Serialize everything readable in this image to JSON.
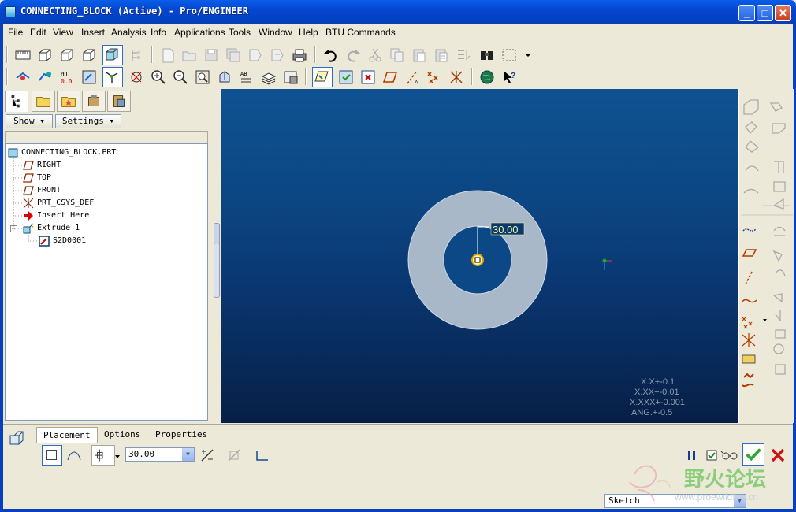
{
  "window": {
    "title": "CONNECTING_BLOCK (Active) - Pro/ENGINEER",
    "minimize_glyph": "_",
    "maximize_glyph": "□",
    "close_glyph": "✕"
  },
  "menu": [
    "File",
    "Edit",
    "View",
    "Insert",
    "Analysis",
    "Info",
    "Applications",
    "Tools",
    "Window",
    "Help",
    "BTU Commands"
  ],
  "navigator": {
    "show_label": "Show",
    "settings_label": "Settings",
    "tree": [
      {
        "label": "CONNECTING_BLOCK.PRT",
        "icon": "part-icon"
      },
      {
        "label": "RIGHT",
        "icon": "datum-plane-icon"
      },
      {
        "label": "TOP",
        "icon": "datum-plane-icon"
      },
      {
        "label": "FRONT",
        "icon": "datum-plane-icon"
      },
      {
        "label": "PRT_CSYS_DEF",
        "icon": "csys-icon"
      },
      {
        "label": "Insert Here",
        "icon": "insert-arrow-icon"
      },
      {
        "label": "Extrude 1",
        "icon": "extrude-icon"
      },
      {
        "label": "S2D0001",
        "icon": "sketch-icon"
      }
    ]
  },
  "graphics": {
    "dimension": "30.00",
    "tolerances": [
      "X.X+-0.1",
      "X.XX+-0.01",
      "X.XXX+-0.001",
      "ANG.+-0.5"
    ]
  },
  "dashboard": {
    "tabs": [
      "Placement",
      "Options",
      "Properties"
    ],
    "depth_value": "30.00"
  },
  "status": {
    "filter_value": "Sketch"
  },
  "watermark": {
    "text_cn": "野火论坛",
    "url": "www.proewildfire.cn"
  },
  "colors": {
    "title_bar": "#0a5ee8",
    "graphics_top": "#0f5292",
    "graphics_bottom": "#071f45",
    "ring": "#a8b8c8",
    "dimension_text": "#f0f0a0",
    "accept_green": "#2fa82f",
    "cancel_red": "#d01010"
  }
}
